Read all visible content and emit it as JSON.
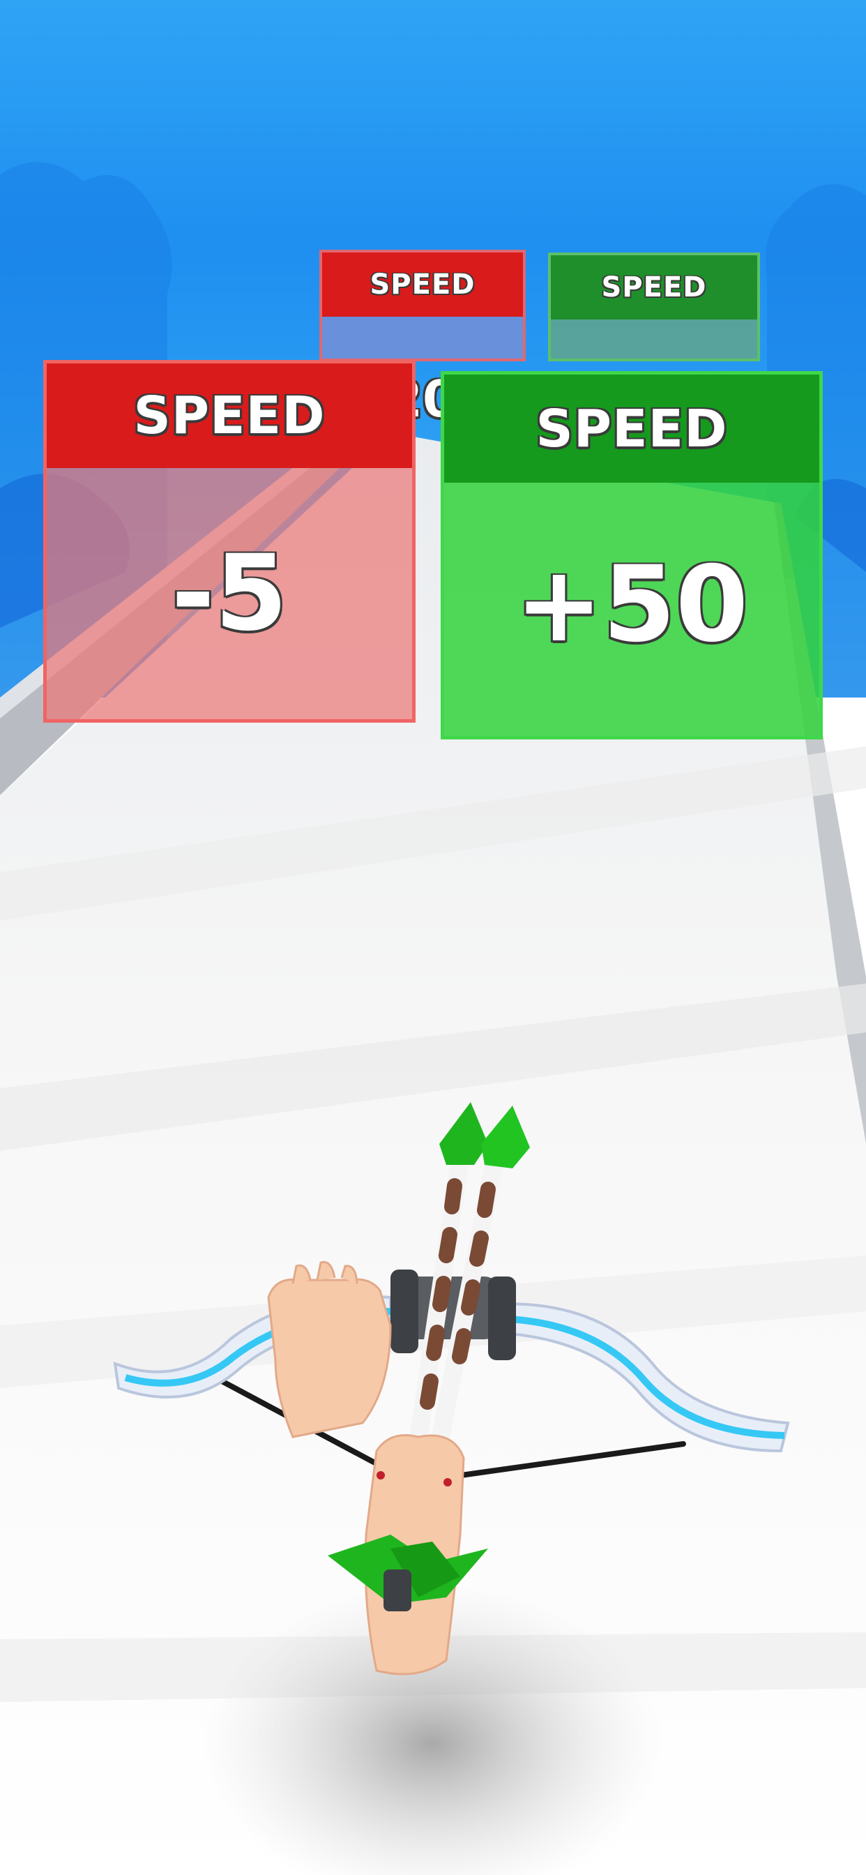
{
  "gates": {
    "back_left": {
      "label": "SPEED",
      "value": "20"
    },
    "back_right": {
      "label": "SPEED"
    },
    "front_left": {
      "label": "SPEED",
      "value": "-5"
    },
    "front_right": {
      "label": "SPEED",
      "value": "+50"
    }
  },
  "colors": {
    "sky": "#2a9cf2",
    "negative_gate": "#e0221c",
    "positive_gate": "#1fbf2a",
    "track": "#f3f3f3",
    "bow_accent": "#35c8f5",
    "arrow_fletching": "#1fb51f"
  }
}
